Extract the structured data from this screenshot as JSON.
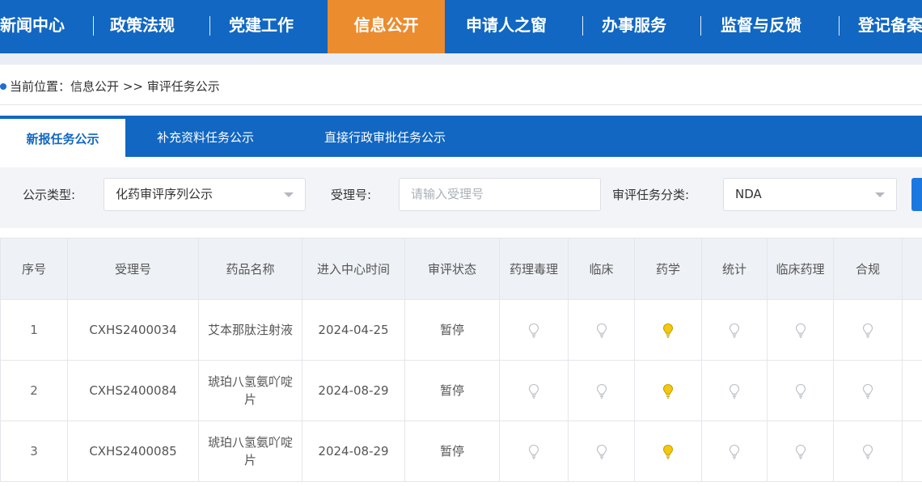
{
  "nav": {
    "items": [
      {
        "label": "新闻中心",
        "active": false
      },
      {
        "label": "政策法规",
        "active": false
      },
      {
        "label": "党建工作",
        "active": false
      },
      {
        "label": "信息公开",
        "active": true
      },
      {
        "label": "申请人之窗",
        "active": false
      },
      {
        "label": "办事服务",
        "active": false
      },
      {
        "label": "监督与反馈",
        "active": false
      },
      {
        "label": "登记备案",
        "active": false
      }
    ]
  },
  "breadcrumb": {
    "prefix": "当前位置：",
    "section": "信息公开",
    "separator": ">>",
    "current": "审评任务公示"
  },
  "tabs": [
    {
      "label": "新报任务公示",
      "active": true
    },
    {
      "label": "补充资料任务公示",
      "active": false
    },
    {
      "label": "直接行政审批任务公示",
      "active": false
    }
  ],
  "filters": {
    "type_label": "公示类型:",
    "type_value": "化药审评序列公示",
    "acceptance_label": "受理号:",
    "acceptance_placeholder": "请输入受理号",
    "category_label": "审评任务分类:",
    "category_value": "NDA"
  },
  "table": {
    "headers": {
      "seq": "序号",
      "acceptance_no": "受理号",
      "drug_name": "药品名称",
      "entry_time": "进入中心时间",
      "status": "审评状态",
      "pharm_tox": "药理毒理",
      "clinical": "临床",
      "pharmacy": "药学",
      "statistics": "统计",
      "clin_pharm": "临床药理",
      "compliance": "合规"
    },
    "rows": [
      {
        "seq": "1",
        "acceptance_no": "CXHS2400034",
        "drug_name": "艾本那肽注射液",
        "entry_time": "2024-04-25",
        "status": "暂停"
      },
      {
        "seq": "2",
        "acceptance_no": "CXHS2400084",
        "drug_name": "琥珀八氢氨吖啶片",
        "entry_time": "2024-08-29",
        "status": "暂停"
      },
      {
        "seq": "3",
        "acceptance_no": "CXHS2400085",
        "drug_name": "琥珀八氢氨吖啶片",
        "entry_time": "2024-08-29",
        "status": "暂停"
      }
    ],
    "indicator_active_column": "pharmacy",
    "icon": "lightbulb-icon"
  },
  "colors": {
    "primary": "#1167c2",
    "nav_active": "#eb8c2e",
    "bulb_on": "#f2c811",
    "bulb_off": "#d0d3d8"
  }
}
